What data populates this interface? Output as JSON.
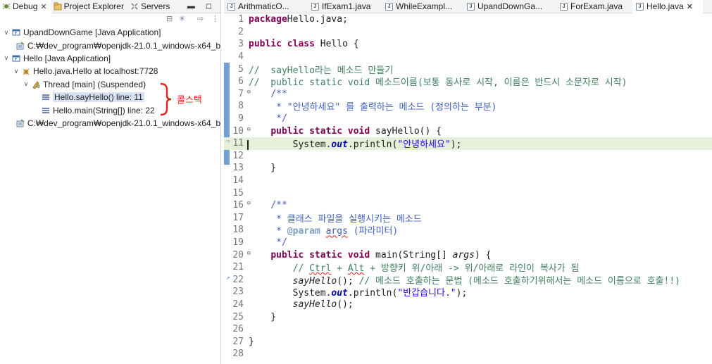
{
  "left_tabs": [
    {
      "label": "Debug",
      "icon": "debug-icon",
      "active": true
    },
    {
      "label": "Project Explorer",
      "icon": "project-explorer-icon",
      "active": false
    },
    {
      "label": "Servers",
      "icon": "servers-icon",
      "active": false
    }
  ],
  "tree": [
    {
      "label": "UpandDownGame [Java Application]",
      "indent": 0,
      "twisty": "∨",
      "icon": "java-app-icon"
    },
    {
      "label": "C:₩dev_program₩openjdk-21.0.1_windows-x64_b",
      "indent": 1,
      "twisty": "",
      "icon": "process-icon"
    },
    {
      "label": "Hello [Java Application]",
      "indent": 0,
      "twisty": "∨",
      "icon": "java-app-icon"
    },
    {
      "label": "Hello.java.Hello at localhost:7728",
      "indent": 1,
      "twisty": "∨",
      "icon": "debug-target-icon"
    },
    {
      "label": "Thread [main] (Suspended)",
      "indent": 2,
      "twisty": "∨",
      "icon": "thread-suspended-icon"
    },
    {
      "label": "Hello.sayHello() line: 11",
      "indent": 3,
      "twisty": "",
      "icon": "stack-frame-icon",
      "selected": true
    },
    {
      "label": "Hello.main(String[]) line: 22",
      "indent": 3,
      "twisty": "",
      "icon": "stack-frame-icon"
    },
    {
      "label": "C:₩dev_program₩openjdk-21.0.1_windows-x64_b",
      "indent": 1,
      "twisty": "",
      "icon": "process-icon"
    }
  ],
  "callstack_annotation": "콜스택",
  "editor_tabs": [
    {
      "label": "ArithmaticO...",
      "active": false
    },
    {
      "label": "IfExam1.java",
      "active": false
    },
    {
      "label": "WhileExampl...",
      "active": false
    },
    {
      "label": "UpandDownGa...",
      "active": false
    },
    {
      "label": "ForExam.java",
      "active": false
    },
    {
      "label": "Hello.java",
      "active": true
    }
  ],
  "colors": {
    "keyword": "#7f0055",
    "comment": "#3f7f5f",
    "javadoc": "#3f5fbf",
    "string": "#2a00ff",
    "current_line": "#e6f0d8",
    "annotation_red": "#e2231a"
  },
  "code_lines": [
    {
      "n": "1",
      "segs": [
        [
          "kw",
          "package"
        ],
        [
          "",
          "Hello.java;"
        ]
      ]
    },
    {
      "n": "2",
      "segs": []
    },
    {
      "n": "3",
      "segs": [
        [
          "kw",
          "public"
        ],
        [
          "",
          " "
        ],
        [
          "kw",
          "class"
        ],
        [
          "",
          " Hello {"
        ]
      ]
    },
    {
      "n": "4",
      "segs": []
    },
    {
      "n": "5",
      "segs": [
        [
          "cm",
          "//  sayHello라는 메소드 만들기"
        ]
      ]
    },
    {
      "n": "6",
      "segs": [
        [
          "cm",
          "//  public static void 메소드이름(보통 동사로 시작, 이름은 반드시 소문자로 시작)"
        ]
      ]
    },
    {
      "n": "7",
      "fold": true,
      "segs": [
        [
          "",
          "    "
        ],
        [
          "jd",
          "/**"
        ]
      ]
    },
    {
      "n": "8",
      "segs": [
        [
          "jd",
          "     * \"안녕하세요\" 를 출력하는 메소드 (정의하는 부분)"
        ]
      ]
    },
    {
      "n": "9",
      "segs": [
        [
          "jd",
          "     */"
        ]
      ]
    },
    {
      "n": "10",
      "fold": true,
      "segs": [
        [
          "",
          "    "
        ],
        [
          "kw",
          "public"
        ],
        [
          "",
          " "
        ],
        [
          "kw",
          "static"
        ],
        [
          "",
          " "
        ],
        [
          "kw",
          "void"
        ],
        [
          "",
          " sayHello() {"
        ]
      ]
    },
    {
      "n": "11",
      "current": true,
      "segs": [
        [
          "",
          "        System."
        ],
        [
          "fld",
          "out"
        ],
        [
          "",
          ".println("
        ],
        [
          "str",
          "\"안녕하세요\""
        ],
        [
          "",
          ");"
        ]
      ]
    },
    {
      "n": "12",
      "segs": []
    },
    {
      "n": "13",
      "segs": [
        [
          "",
          "    }"
        ]
      ]
    },
    {
      "n": "14",
      "segs": []
    },
    {
      "n": "15",
      "segs": []
    },
    {
      "n": "16",
      "fold": true,
      "segs": [
        [
          "",
          "    "
        ],
        [
          "jd",
          "/**"
        ]
      ]
    },
    {
      "n": "17",
      "segs": [
        [
          "jd",
          "     * 클래스 파일을 실행시키는 메소드"
        ]
      ]
    },
    {
      "n": "18",
      "segs": [
        [
          "jd",
          "     * "
        ],
        [
          "jdtag",
          "@param"
        ],
        [
          "jd",
          " "
        ],
        [
          "jdsq",
          "args"
        ],
        [
          "jd",
          " (파라미터)"
        ]
      ]
    },
    {
      "n": "19",
      "segs": [
        [
          "jd",
          "     */"
        ]
      ]
    },
    {
      "n": "20",
      "fold": true,
      "segs": [
        [
          "",
          "    "
        ],
        [
          "kw",
          "public"
        ],
        [
          "",
          " "
        ],
        [
          "kw",
          "static"
        ],
        [
          "",
          " "
        ],
        [
          "kw",
          "void"
        ],
        [
          "",
          " main(String[] "
        ],
        [
          "st",
          "args"
        ],
        [
          "",
          ") {"
        ]
      ]
    },
    {
      "n": "21",
      "segs": [
        [
          "cm",
          "        // "
        ],
        [
          "cmsq",
          "Ctrl"
        ],
        [
          "cm",
          " + "
        ],
        [
          "cmsq",
          "Alt"
        ],
        [
          "cm",
          " + 방향키 위/아래 -> 위/아래로 라인이 복사가 됨"
        ]
      ]
    },
    {
      "n": "22",
      "marker": true,
      "segs": [
        [
          "",
          "        "
        ],
        [
          "st",
          "sayHello"
        ],
        [
          "",
          "(); "
        ],
        [
          "cm",
          "// 메소드 호출하는 문법 (메소드 호출하기위해서는 메소드 이름으로 호출!!)"
        ]
      ]
    },
    {
      "n": "23",
      "segs": [
        [
          "",
          "        System."
        ],
        [
          "fld",
          "out"
        ],
        [
          "",
          ".println("
        ],
        [
          "str",
          "\"반갑습니다.\""
        ],
        [
          "",
          ");"
        ]
      ]
    },
    {
      "n": "24",
      "segs": [
        [
          "",
          "        "
        ],
        [
          "st",
          "sayHello"
        ],
        [
          "",
          "();"
        ]
      ]
    },
    {
      "n": "25",
      "segs": [
        [
          "",
          "    }"
        ]
      ]
    },
    {
      "n": "26",
      "segs": []
    },
    {
      "n": "27",
      "segs": [
        [
          "",
          "}"
        ]
      ]
    },
    {
      "n": "28",
      "segs": []
    }
  ]
}
